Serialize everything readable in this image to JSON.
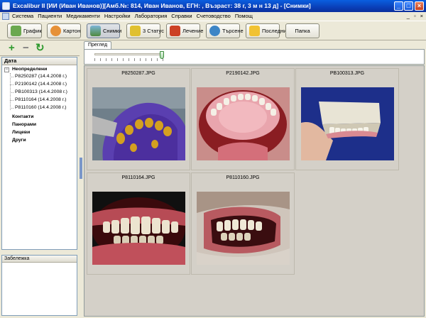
{
  "window": {
    "title": "Excalibur II [ИИ (Иван Иванов)][Амб.№: 814, Иван Иванов, ЕГН: , Възраст: 38 г, 3 м н 13 д] - [Снимки]",
    "minimize": "_",
    "maximize": "□",
    "close": "×"
  },
  "menu": [
    "Система",
    "Пациенти",
    "Медикаменти",
    "Настройки",
    "Лаборатория",
    "Справки",
    "Счетоводство",
    "Помощ"
  ],
  "mdi_controls": [
    "_",
    "▫",
    "×"
  ],
  "toolbar": {
    "buttons": [
      {
        "label": "График",
        "icon": "calendar-icon",
        "color": "#6aa84f"
      },
      {
        "label": "Картон",
        "icon": "patient-card-icon",
        "color": "#e69138"
      },
      {
        "label": "Снимки",
        "icon": "photos-icon",
        "color": "#7db5d8"
      },
      {
        "label": "3 Статус",
        "icon": "tooth-status-icon",
        "color": "#e0c030"
      },
      {
        "label": "Лечение",
        "icon": "treatment-icon",
        "color": "#cc4125"
      },
      {
        "label": "Търсене",
        "icon": "search-icon",
        "color": "#3d85c6"
      },
      {
        "label": "Последни",
        "icon": "recent-icon",
        "color": "#f1c232"
      },
      {
        "label": "Папка",
        "icon": "folder-icon",
        "color": ""
      }
    ],
    "active_index": 2
  },
  "tree_tools": {
    "add": "+",
    "remove": "−",
    "refresh": "↻"
  },
  "tree": {
    "header": "Дата",
    "root": "Неопределени",
    "root_expander": "−",
    "children": [
      "P8250287 (14.4.2008 г.)",
      "P2190142 (14.4.2008 г.)",
      "PB100313 (14.4.2008 г.)",
      "P8110164 (14.4.2008 г.)",
      "P8110160 (14.4.2008 г.)"
    ],
    "groups": [
      "Контакти",
      "Панорами",
      "Лицеви",
      "Други"
    ]
  },
  "note": {
    "header": "Забележка",
    "value": ""
  },
  "tab": {
    "label": "Преглед"
  },
  "zoom_slider": {
    "value_fraction": 1.0
  },
  "photos": [
    {
      "filename": "P8250287.JPG",
      "subject": "dental-impression-tray"
    },
    {
      "filename": "P2190142.JPG",
      "subject": "upper-denture-mouth"
    },
    {
      "filename": "PB100313.JPG",
      "subject": "plaster-model-hand"
    },
    {
      "filename": "P8110164.JPG",
      "subject": "front-teeth"
    },
    {
      "filename": "P8110160.JPG",
      "subject": "lateral-teeth-retractor"
    }
  ]
}
